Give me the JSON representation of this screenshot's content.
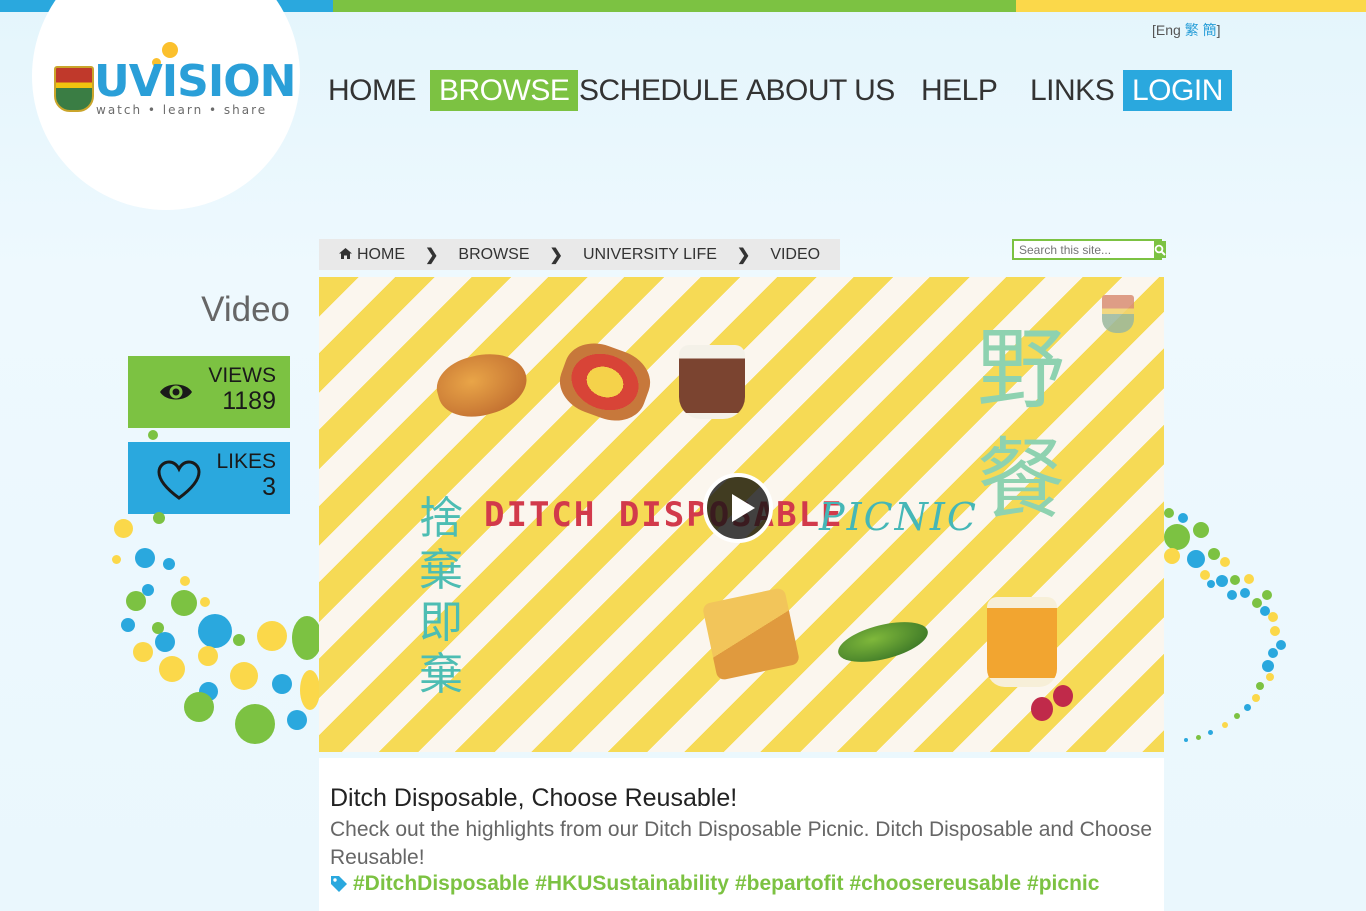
{
  "brand": {
    "name": "UVISION",
    "tagline": "watch • learn • share",
    "colors": {
      "blue": "#2aa8de",
      "green": "#7cc242",
      "yellow": "#fbc02d"
    }
  },
  "language": {
    "open": "[",
    "eng": "Eng",
    "traditional": "繁",
    "simplified": "簡",
    "close": "]"
  },
  "nav": {
    "items": [
      {
        "label": "HOME"
      },
      {
        "label": "BROWSE"
      },
      {
        "label": "SCHEDULE"
      },
      {
        "label": "ABOUT US"
      },
      {
        "label": "HELP"
      },
      {
        "label": "LINKS"
      },
      {
        "label": "LOGIN"
      }
    ]
  },
  "breadcrumb": [
    {
      "label": "HOME",
      "icon": "home-icon"
    },
    {
      "label": "BROWSE"
    },
    {
      "label": "UNIVERSITY LIFE"
    },
    {
      "label": "VIDEO"
    }
  ],
  "search": {
    "placeholder": "Search this site..."
  },
  "sidebar": {
    "title": "Video",
    "views": {
      "label": "VIEWS",
      "value": "1189",
      "icon": "eye-icon"
    },
    "likes": {
      "label": "LIKES",
      "value": "3",
      "icon": "heart-icon"
    }
  },
  "video": {
    "title_left": "DITCH DISPOSABLE",
    "title_right": "PICNIC",
    "zh_left": "捨棄即棄",
    "zh_right": "野餐",
    "play_icon": "play-icon"
  },
  "info": {
    "title": "Ditch Disposable, Choose Reusable!",
    "description": "Check out the highlights from our Ditch Disposable Picnic. Ditch Disposable and Choose Reusable!",
    "tags": [
      "#DitchDisposable",
      "#HKUSustainability",
      "#bepartofit",
      "#choosereusable",
      "#picnic"
    ],
    "tag_icon": "tag-icon"
  }
}
